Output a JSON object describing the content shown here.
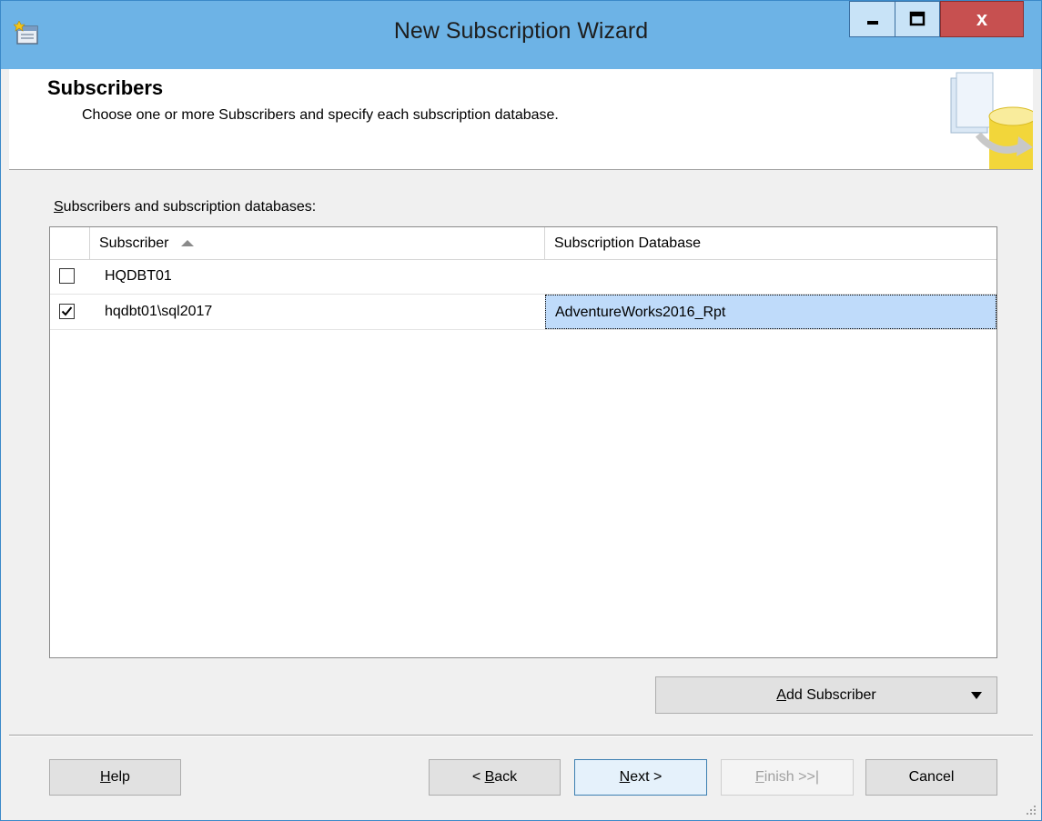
{
  "window": {
    "title": "New Subscription Wizard",
    "close_glyph": "x"
  },
  "header": {
    "title": "Subscribers",
    "description": "Choose one or more Subscribers and specify each subscription database."
  },
  "list": {
    "label_mnemonic": "S",
    "label_rest": "ubscribers and subscription databases:",
    "columns": {
      "subscriber": "Subscriber",
      "database": "Subscription Database"
    },
    "rows": [
      {
        "checked": false,
        "subscriber": "HQDBT01",
        "database": ""
      },
      {
        "checked": true,
        "subscriber": "hqdbt01\\sql2017",
        "database": "AdventureWorks2016_Rpt"
      }
    ]
  },
  "add_subscriber": {
    "mnemonic": "A",
    "rest": "dd Subscriber"
  },
  "buttons": {
    "help": {
      "mnemonic": "H",
      "rest": "elp"
    },
    "back": {
      "prefix": "< ",
      "mnemonic": "B",
      "rest": "ack"
    },
    "next": {
      "mnemonic": "N",
      "rest": "ext >"
    },
    "finish": {
      "mnemonic": "F",
      "rest": "inish >>|"
    },
    "cancel": "Cancel"
  },
  "colors": {
    "titlebar": "#6db3e6",
    "close": "#c75050",
    "selection": "#bfdbfa"
  }
}
